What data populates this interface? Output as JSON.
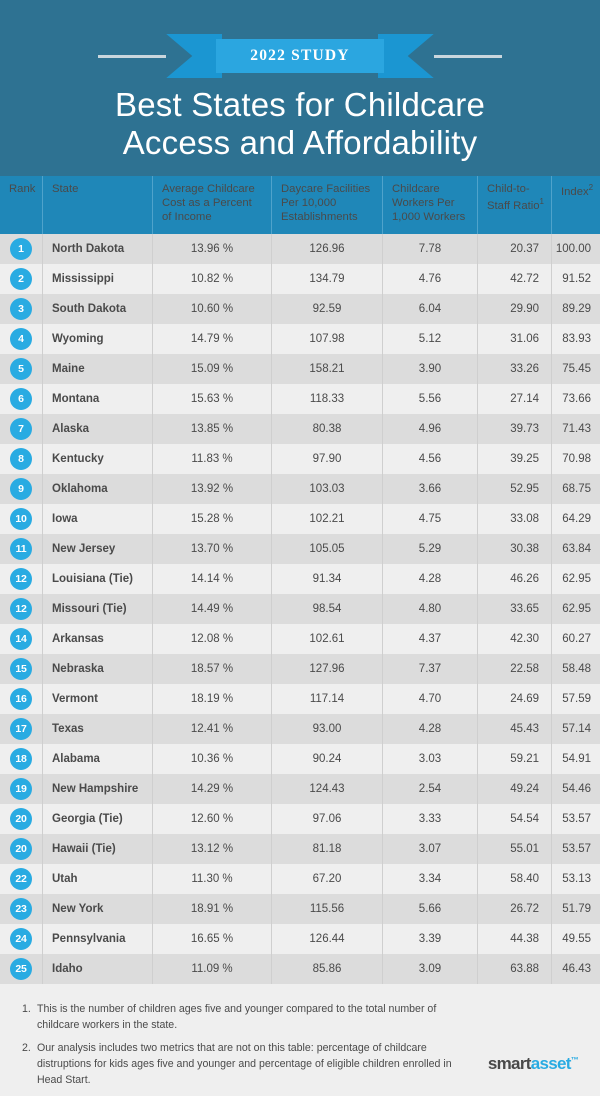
{
  "hero": {
    "ribbon_label": "2022 STUDY",
    "title_line1": "Best States for Childcare",
    "title_line2": "Access and Affordability"
  },
  "table": {
    "headers": {
      "rank": "Rank",
      "state": "State",
      "cost": "Average Childcare Cost as a Percent of Income",
      "facilities": "Daycare Facilities Per 10,000 Establishments",
      "workers": "Childcare Workers Per 1,000 Workers",
      "ratio": "Child-to-Staff Ratio",
      "ratio_sup": "1",
      "index": "Index",
      "index_sup": "2"
    },
    "rows": [
      {
        "rank": "1",
        "state": "North Dakota",
        "cost": "13.96 %",
        "facilities": "126.96",
        "workers": "7.78",
        "ratio": "20.37",
        "index": "100.00"
      },
      {
        "rank": "2",
        "state": "Mississippi",
        "cost": "10.82 %",
        "facilities": "134.79",
        "workers": "4.76",
        "ratio": "42.72",
        "index": "91.52"
      },
      {
        "rank": "3",
        "state": "South Dakota",
        "cost": "10.60 %",
        "facilities": "92.59",
        "workers": "6.04",
        "ratio": "29.90",
        "index": "89.29"
      },
      {
        "rank": "4",
        "state": "Wyoming",
        "cost": "14.79 %",
        "facilities": "107.98",
        "workers": "5.12",
        "ratio": "31.06",
        "index": "83.93"
      },
      {
        "rank": "5",
        "state": "Maine",
        "cost": "15.09 %",
        "facilities": "158.21",
        "workers": "3.90",
        "ratio": "33.26",
        "index": "75.45"
      },
      {
        "rank": "6",
        "state": "Montana",
        "cost": "15.63 %",
        "facilities": "118.33",
        "workers": "5.56",
        "ratio": "27.14",
        "index": "73.66"
      },
      {
        "rank": "7",
        "state": "Alaska",
        "cost": "13.85 %",
        "facilities": "80.38",
        "workers": "4.96",
        "ratio": "39.73",
        "index": "71.43"
      },
      {
        "rank": "8",
        "state": "Kentucky",
        "cost": "11.83 %",
        "facilities": "97.90",
        "workers": "4.56",
        "ratio": "39.25",
        "index": "70.98"
      },
      {
        "rank": "9",
        "state": "Oklahoma",
        "cost": "13.92 %",
        "facilities": "103.03",
        "workers": "3.66",
        "ratio": "52.95",
        "index": "68.75"
      },
      {
        "rank": "10",
        "state": "Iowa",
        "cost": "15.28 %",
        "facilities": "102.21",
        "workers": "4.75",
        "ratio": "33.08",
        "index": "64.29"
      },
      {
        "rank": "11",
        "state": "New Jersey",
        "cost": "13.70 %",
        "facilities": "105.05",
        "workers": "5.29",
        "ratio": "30.38",
        "index": "63.84"
      },
      {
        "rank": "12",
        "state": "Louisiana (Tie)",
        "cost": "14.14 %",
        "facilities": "91.34",
        "workers": "4.28",
        "ratio": "46.26",
        "index": "62.95"
      },
      {
        "rank": "12",
        "state": "Missouri (Tie)",
        "cost": "14.49 %",
        "facilities": "98.54",
        "workers": "4.80",
        "ratio": "33.65",
        "index": "62.95"
      },
      {
        "rank": "14",
        "state": "Arkansas",
        "cost": "12.08 %",
        "facilities": "102.61",
        "workers": "4.37",
        "ratio": "42.30",
        "index": "60.27"
      },
      {
        "rank": "15",
        "state": "Nebraska",
        "cost": "18.57 %",
        "facilities": "127.96",
        "workers": "7.37",
        "ratio": "22.58",
        "index": "58.48"
      },
      {
        "rank": "16",
        "state": "Vermont",
        "cost": "18.19 %",
        "facilities": "117.14",
        "workers": "4.70",
        "ratio": "24.69",
        "index": "57.59"
      },
      {
        "rank": "17",
        "state": "Texas",
        "cost": "12.41 %",
        "facilities": "93.00",
        "workers": "4.28",
        "ratio": "45.43",
        "index": "57.14"
      },
      {
        "rank": "18",
        "state": "Alabama",
        "cost": "10.36 %",
        "facilities": "90.24",
        "workers": "3.03",
        "ratio": "59.21",
        "index": "54.91"
      },
      {
        "rank": "19",
        "state": "New Hampshire",
        "cost": "14.29 %",
        "facilities": "124.43",
        "workers": "2.54",
        "ratio": "49.24",
        "index": "54.46"
      },
      {
        "rank": "20",
        "state": "Georgia (Tie)",
        "cost": "12.60 %",
        "facilities": "97.06",
        "workers": "3.33",
        "ratio": "54.54",
        "index": "53.57"
      },
      {
        "rank": "20",
        "state": "Hawaii (Tie)",
        "cost": "13.12 %",
        "facilities": "81.18",
        "workers": "3.07",
        "ratio": "55.01",
        "index": "53.57"
      },
      {
        "rank": "22",
        "state": "Utah",
        "cost": "11.30 %",
        "facilities": "67.20",
        "workers": "3.34",
        "ratio": "58.40",
        "index": "53.13"
      },
      {
        "rank": "23",
        "state": "New York",
        "cost": "18.91 %",
        "facilities": "115.56",
        "workers": "5.66",
        "ratio": "26.72",
        "index": "51.79"
      },
      {
        "rank": "24",
        "state": "Pennsylvania",
        "cost": "16.65 %",
        "facilities": "126.44",
        "workers": "3.39",
        "ratio": "44.38",
        "index": "49.55"
      },
      {
        "rank": "25",
        "state": "Idaho",
        "cost": "11.09 %",
        "facilities": "85.86",
        "workers": "3.09",
        "ratio": "63.88",
        "index": "46.43"
      }
    ]
  },
  "footnotes": [
    {
      "num": "1.",
      "text": "This is the number of children ages five and younger compared to the total number of childcare workers in the state."
    },
    {
      "num": "2.",
      "text": "Our analysis includes two metrics that are not on this table: percentage of childcare distruptions for kids ages five and younger and percentage of eligible children enrolled in Head Start."
    }
  ],
  "logo": {
    "part1": "smart",
    "part2": "asset",
    "tm": "™"
  },
  "colors": {
    "hero_bg": "#2e7292",
    "header_bg": "#1f87b8",
    "accent": "#29abe2",
    "row_odd": "#dcdcdc",
    "row_even": "#efefef"
  }
}
